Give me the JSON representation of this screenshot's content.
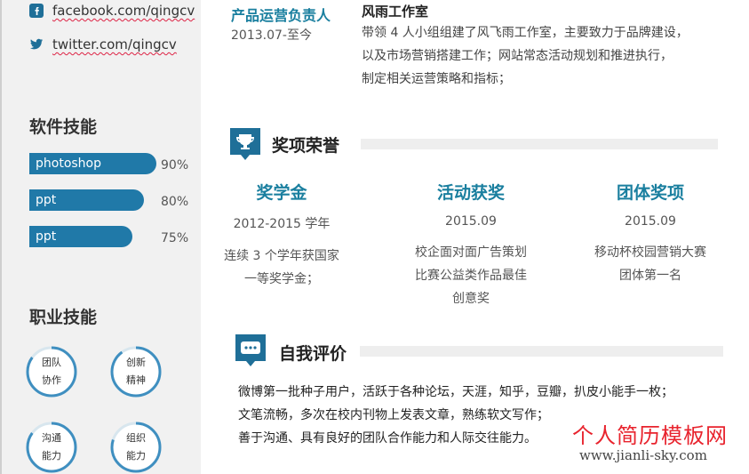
{
  "sidebar": {
    "social": [
      {
        "icon": "facebook-icon",
        "text": "facebook.com/qingcv"
      },
      {
        "icon": "twitter-icon",
        "text": "twitter.com/qingcv"
      }
    ],
    "software_heading": "软件技能",
    "software_skills": [
      {
        "name": "photoshop",
        "percent_label": "90%",
        "level": 0.9
      },
      {
        "name": "ppt",
        "percent_label": "80%",
        "level": 0.8
      },
      {
        "name": "ppt",
        "percent_label": "75%",
        "level": 0.75
      }
    ],
    "career_heading": "职业技能",
    "career_skills": [
      {
        "line1": "团队",
        "line2": "协作",
        "level": 0.85
      },
      {
        "line1": "创新",
        "line2": "精神",
        "level": 0.9
      },
      {
        "line1": "沟通",
        "line2": "能力",
        "level": 0.85
      },
      {
        "line1": "组织",
        "line2": "能力",
        "level": 0.8
      }
    ]
  },
  "experience": {
    "title": "产品运营负责人",
    "date": "2013.07-至今",
    "company": "风雨工作室",
    "desc_lines": [
      "带领 4 人小组组建了风飞雨工作室，主要致力于品牌建设，",
      "以及市场营销搭建工作；网站常态活动规划和推进执行，",
      "制定相关运营策略和指标；"
    ]
  },
  "awards": {
    "heading": "奖项荣誉",
    "items": [
      {
        "title": "奖学金",
        "date": "2012-2015 学年",
        "desc_lines": [
          "连续 3 个学年获国家",
          "一等奖学金；"
        ]
      },
      {
        "title": "活动获奖",
        "date": "2015.09",
        "desc_lines": [
          "校企面对面广告策划",
          "比赛公益类作品最佳",
          "创意奖"
        ]
      },
      {
        "title": "团体奖项",
        "date": "2015.09",
        "desc_lines": [
          "移动杯校园营销大赛",
          "团体第一名"
        ]
      }
    ]
  },
  "self_eval": {
    "heading": "自我评价",
    "lines": [
      "微博第一批种子用户，活跃于各种论坛，天涯，知乎，豆瓣，扒皮小能手一枚；",
      "文笔流畅，多次在校内刊物上发表文章，熟练软文写作；",
      "善于沟通、具有良好的团队合作能力和人际交往能力。"
    ]
  },
  "watermark": {
    "title": "个人简历模板网",
    "url": "www.jianli-sky.com"
  },
  "colors": {
    "accent": "#1a7f9f",
    "bar": "#2079a8",
    "sidebar": "#f1f1f1",
    "watermark": "#e8232d"
  }
}
